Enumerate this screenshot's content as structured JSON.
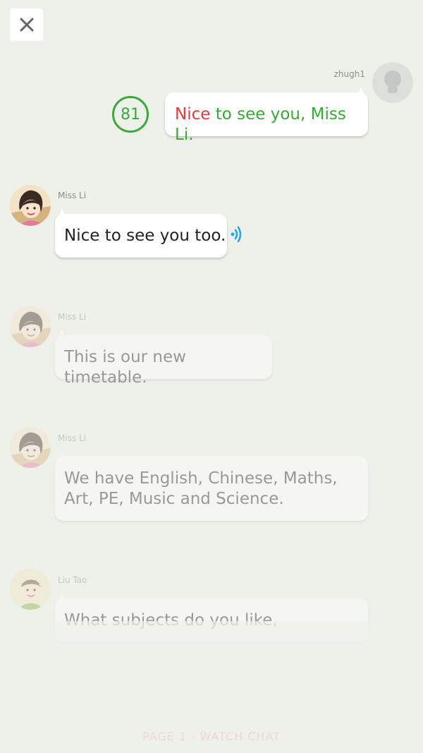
{
  "header": {
    "close_icon": "close-icon"
  },
  "messages": [
    {
      "sender": "zhugh1",
      "side": "right",
      "score": "81",
      "words": [
        {
          "text": "Nice",
          "status": "wrong",
          "color": "#e23b3b"
        },
        {
          "text": " to see you, Miss Li.",
          "status": "correct",
          "color": "#37a937"
        }
      ]
    },
    {
      "sender": "Miss Li",
      "side": "left",
      "text": "Nice to see you too.",
      "audio_icon": "speaker-waves-icon"
    },
    {
      "sender": "Miss Li",
      "side": "left",
      "text": "This is our new timetable."
    },
    {
      "sender": "Miss Li",
      "side": "left",
      "text_line1": "We have English, Chinese, Maths,",
      "text_line2": "Art, PE, Music and Science."
    },
    {
      "sender": "Liu Tao",
      "side": "left",
      "text": "What subjects do you like,"
    }
  ],
  "footer": {
    "text": "PAGE 1 · WATCH CHAT"
  },
  "colors": {
    "background": "#eef0ea",
    "score_green": "#3aa83a",
    "wrong_red": "#e23b3b",
    "audio_blue": "#29a6e6"
  }
}
